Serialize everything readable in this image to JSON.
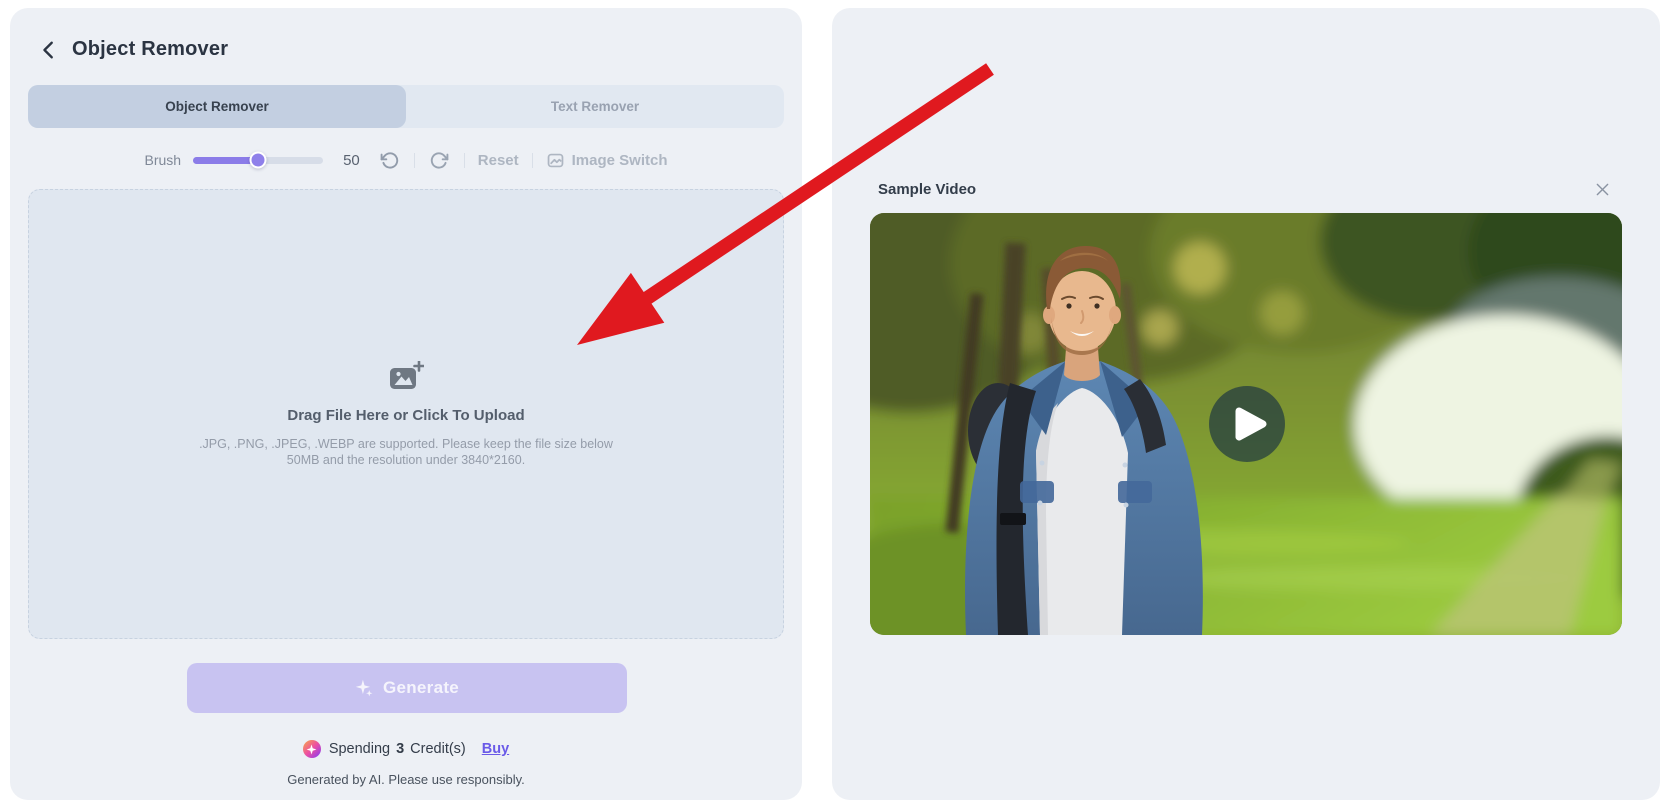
{
  "left_panel": {
    "header": {
      "title": "Object Remover"
    },
    "tabs": [
      {
        "label": "Object Remover",
        "active": true
      },
      {
        "label": "Text Remover",
        "active": false
      }
    ],
    "toolbar": {
      "brush_label": "Brush",
      "brush_value": "50",
      "brush_percent": 50,
      "reset_label": "Reset",
      "image_switch_label": "Image Switch"
    },
    "upload": {
      "title": "Drag File Here or Click To Upload",
      "hint_line1": ".JPG, .PNG, .JPEG, .WEBP are supported. Please keep the file size below",
      "hint_line2": "50MB and the resolution under 3840*2160."
    },
    "generate_button": {
      "label": "Generate"
    },
    "credits": {
      "spending_prefix": "Spending",
      "amount": "3",
      "spending_suffix": "Credit(s)",
      "buy_label": "Buy"
    },
    "disclaimer": "Generated by AI. Please use responsibly."
  },
  "right_panel": {
    "sample_video": {
      "title": "Sample Video"
    }
  },
  "colors": {
    "panel_bg": "#EDF0F5",
    "tabbar_bg": "#E1E8F1",
    "active_tab_bg": "#C3CFE1",
    "upload_bg": "#E0E7F0",
    "accent_purple": "#8B7CE8",
    "generate_bg": "#C8C3F1",
    "buy_link": "#6A5AE8",
    "arrow_red": "#E0191F"
  }
}
